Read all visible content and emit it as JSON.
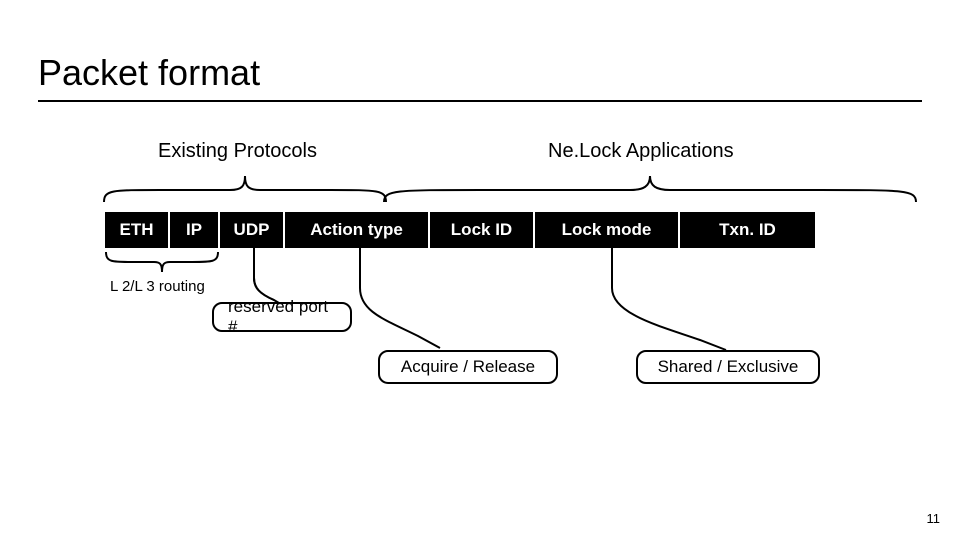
{
  "title": "Packet format",
  "groups": {
    "existing": "Existing Protocols",
    "nelock": "Ne.Lock Applications"
  },
  "cells": {
    "eth": "ETH",
    "ip": "IP",
    "udp": "UDP",
    "action": "Action type",
    "lockid": "Lock ID",
    "mode": "Lock mode",
    "txn": "Txn. ID"
  },
  "labels": {
    "l2l3": "L 2/L 3 routing",
    "reserved_port": "reserved port #",
    "acquire_release": "Acquire / Release",
    "shared_exclusive": "Shared / Exclusive"
  },
  "page_number": "11"
}
